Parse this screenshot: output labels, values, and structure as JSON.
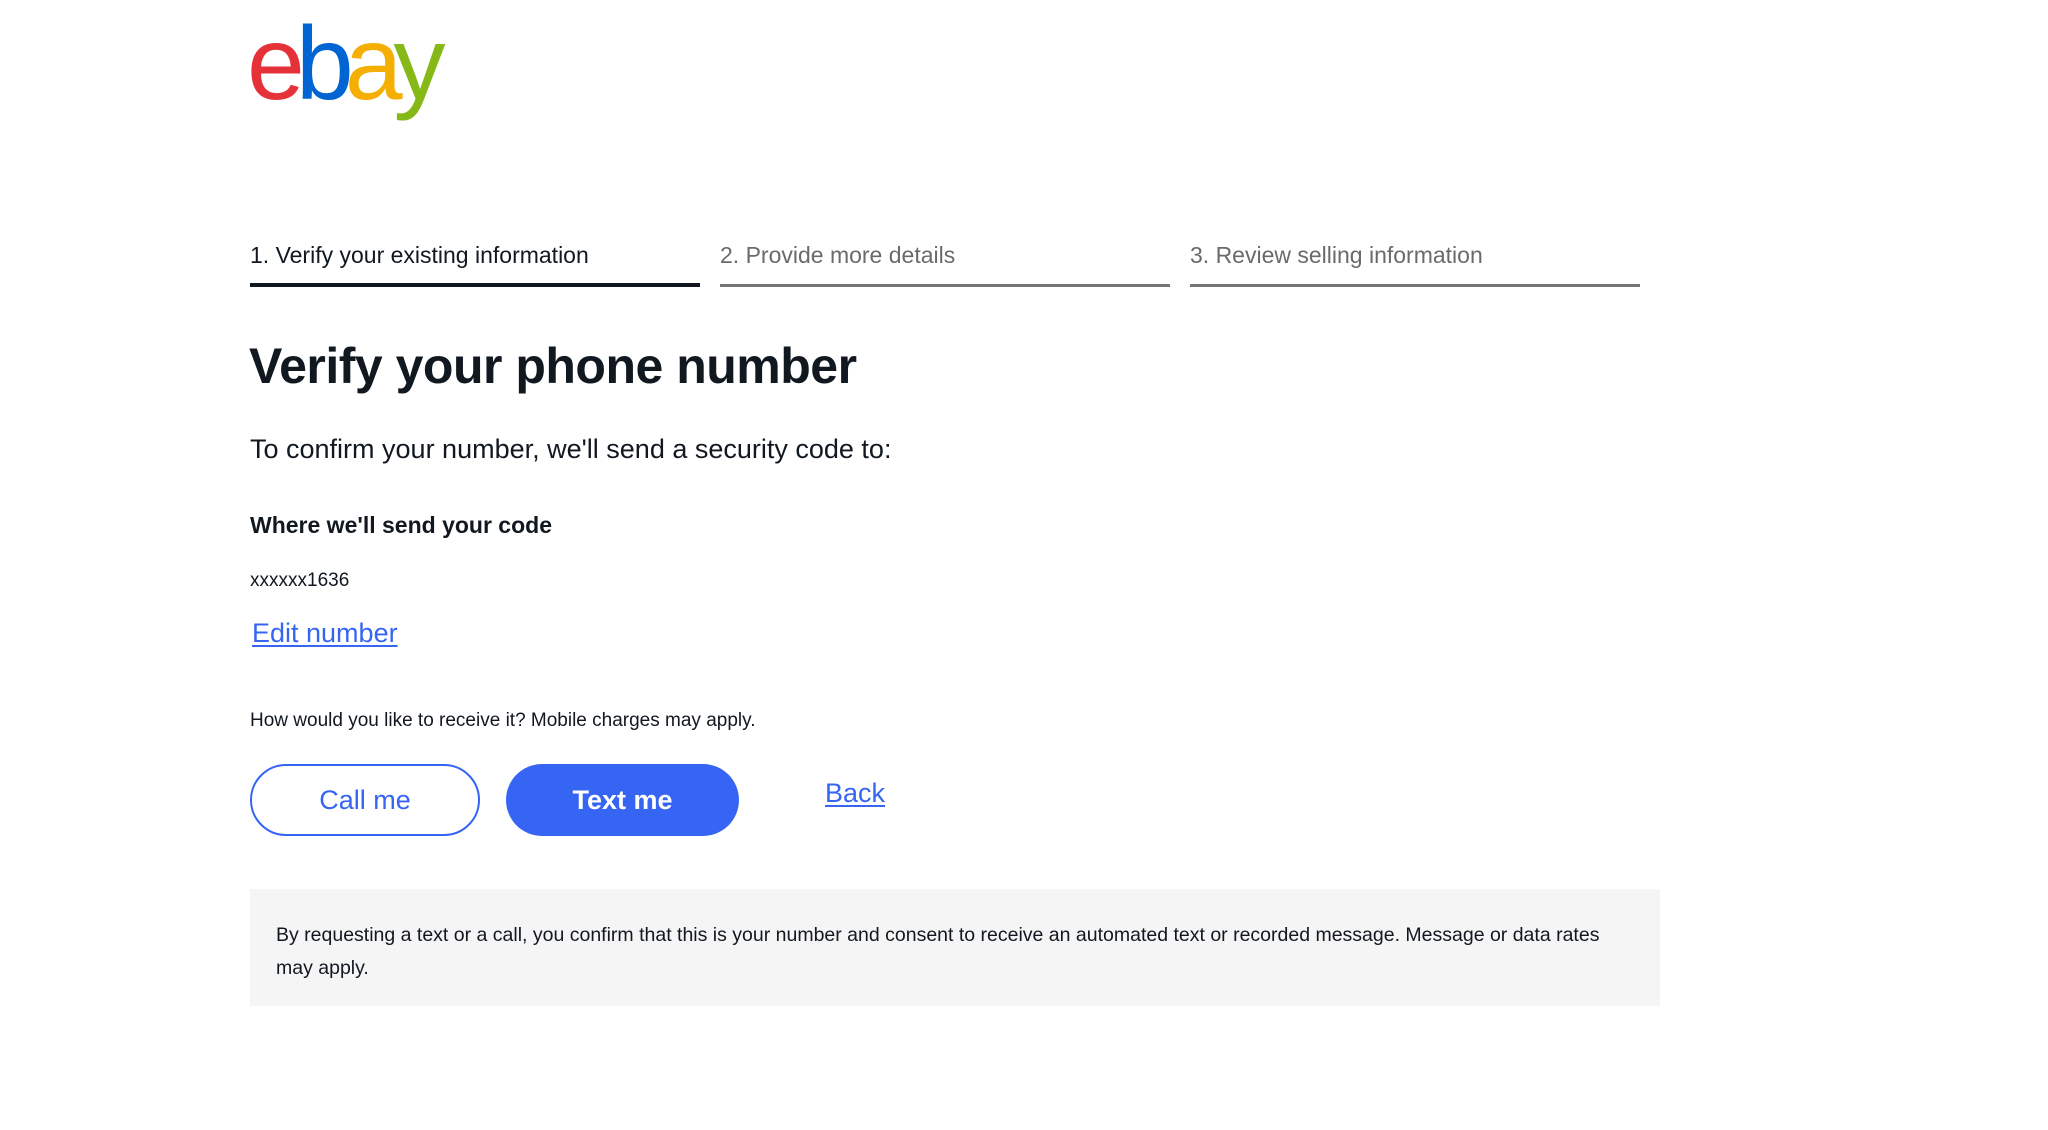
{
  "logo": {
    "letters": [
      "e",
      "b",
      "a",
      "y"
    ],
    "colors": [
      "#e53238",
      "#0064d2",
      "#f5af02",
      "#86b817"
    ]
  },
  "stepper": {
    "steps": [
      {
        "label": "1. Verify your existing information",
        "active": true
      },
      {
        "label": "2. Provide more details",
        "active": false
      },
      {
        "label": "3. Review selling information",
        "active": false
      }
    ]
  },
  "main": {
    "title": "Verify your phone number",
    "intro": "To confirm your number, we'll send a security code to:",
    "destination_label": "Where we'll send your code",
    "phone_masked": "xxxxxx1636",
    "edit_link": "Edit number",
    "delivery_question": "How would you like to receive it? Mobile charges may apply."
  },
  "actions": {
    "call_label": "Call me",
    "text_label": "Text me",
    "back_label": "Back"
  },
  "disclaimer": {
    "text": "By requesting a text or a call, you confirm that this is your number and consent to receive an automated text or recorded message. Message or data rates may apply."
  },
  "colors": {
    "accent": "#3665f3",
    "text": "#111820",
    "muted": "#6a6a6a",
    "disclaimer_bg": "#f5f5f5"
  }
}
